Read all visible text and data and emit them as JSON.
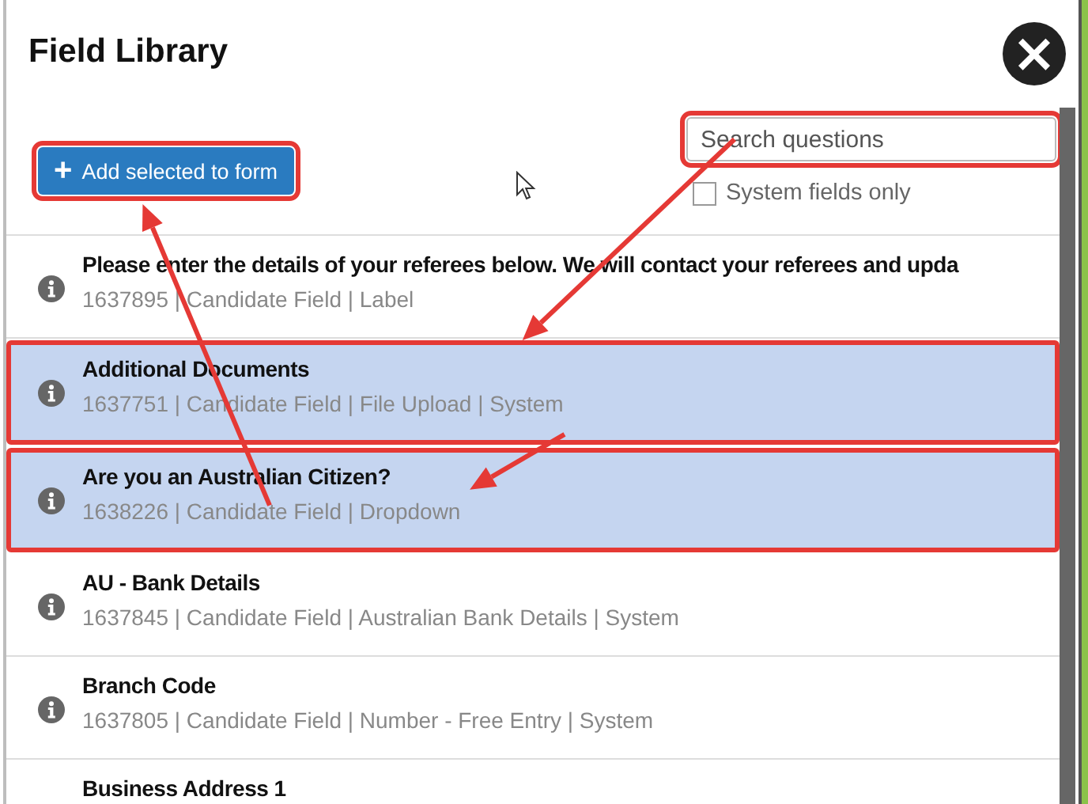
{
  "dialog": {
    "title": "Field Library",
    "close_icon": "×"
  },
  "toolbar": {
    "add_button": {
      "icon": "+",
      "label": "Add selected to form",
      "highlighted": true
    },
    "search": {
      "placeholder": "Search questions",
      "highlighted": true
    },
    "system_only": {
      "label": "System fields only",
      "checked": false
    }
  },
  "rows": [
    {
      "title": "Please enter the details of your referees below. We will contact your referees and upda",
      "meta": "1637895 | Candidate Field | Label",
      "selected": false,
      "highlighted": false
    },
    {
      "title": "Additional Documents",
      "meta": "1637751 | Candidate Field | File Upload | System",
      "selected": true,
      "highlighted": true
    },
    {
      "title": "Are you an Australian Citizen?",
      "meta": "1638226 | Candidate Field | Dropdown",
      "selected": true,
      "highlighted": true
    },
    {
      "title": "AU - Bank Details",
      "meta": "1637845 | Candidate Field | Australian Bank Details | System",
      "selected": false,
      "highlighted": false
    },
    {
      "title": "Branch Code",
      "meta": "1637805 | Candidate Field | Number - Free Entry | System",
      "selected": false,
      "highlighted": false
    },
    {
      "title": "Business Address 1",
      "selected": false,
      "highlighted": false
    }
  ],
  "arrows": [
    {
      "kind": "pointer"
    },
    {
      "kind": "pointer"
    },
    {
      "kind": "pointer"
    }
  ]
}
